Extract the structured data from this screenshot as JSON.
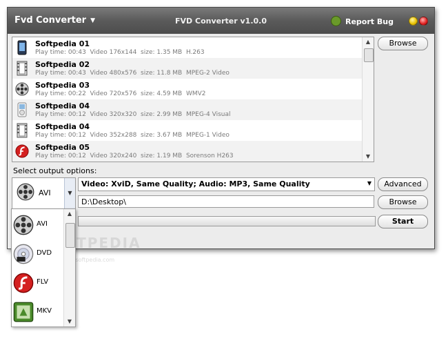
{
  "titlebar": {
    "app_menu": "Fvd Converter",
    "title": "FVD Converter v1.0.0",
    "report_bug": "Report Bug"
  },
  "files": [
    {
      "name": "Softpedia 01",
      "play_time": "Play time: 00:43",
      "video": "Video 176x144",
      "size": "size: 1.35 MB",
      "codec": "H.263",
      "icon": "phone-icon"
    },
    {
      "name": "Softpedia 02",
      "play_time": "Play time: 00:43",
      "video": "Video 480x576",
      "size": "size: 11.8 MB",
      "codec": "MPEG-2 Video",
      "icon": "film-strip-icon"
    },
    {
      "name": "Softpedia 03",
      "play_time": "Play time: 00:22",
      "video": "Video 720x576",
      "size": "size: 4.59 MB",
      "codec": "WMV2",
      "icon": "film-reel-icon"
    },
    {
      "name": "Softpedia 04",
      "play_time": "Play time: 00:12",
      "video": "Video 320x320",
      "size": "size: 2.99 MB",
      "codec": "MPEG-4 Visual",
      "icon": "ipod-icon"
    },
    {
      "name": "Softpedia 04",
      "play_time": "Play time: 00:12",
      "video": "Video 352x288",
      "size": "size: 3.67 MB",
      "codec": "MPEG-1 Video",
      "icon": "film-strip-icon"
    },
    {
      "name": "Softpedia 05",
      "play_time": "Play time: 00:12",
      "video": "Video 320x240",
      "size": "size: 1.19 MB",
      "codec": "Sorenson H263",
      "icon": "flash-icon"
    }
  ],
  "buttons": {
    "browse_files": "Browse",
    "advanced": "Advanced",
    "browse_output": "Browse",
    "start": "Start"
  },
  "output": {
    "label": "Select output options:",
    "format": "AVI",
    "preset": "Video: XviD, Same Quality; Audio: MP3, Same Quality",
    "path": "D:\\Desktop\\"
  },
  "progress": 0,
  "format_options": [
    {
      "label": "AVI",
      "icon": "film-reel-icon"
    },
    {
      "label": "DVD",
      "icon": "dvd-disc-icon"
    },
    {
      "label": "FLV",
      "icon": "flash-icon"
    },
    {
      "label": "MKV",
      "icon": "mkv-icon"
    }
  ],
  "watermark": {
    "text": "SOFTPEDIA",
    "sub": "www.softpedia.com"
  },
  "colors": {
    "titlebar": "#5a5a5a",
    "window_bg": "#ececec",
    "row_alt": "#f2f2f2",
    "flash_red": "#d42020"
  }
}
